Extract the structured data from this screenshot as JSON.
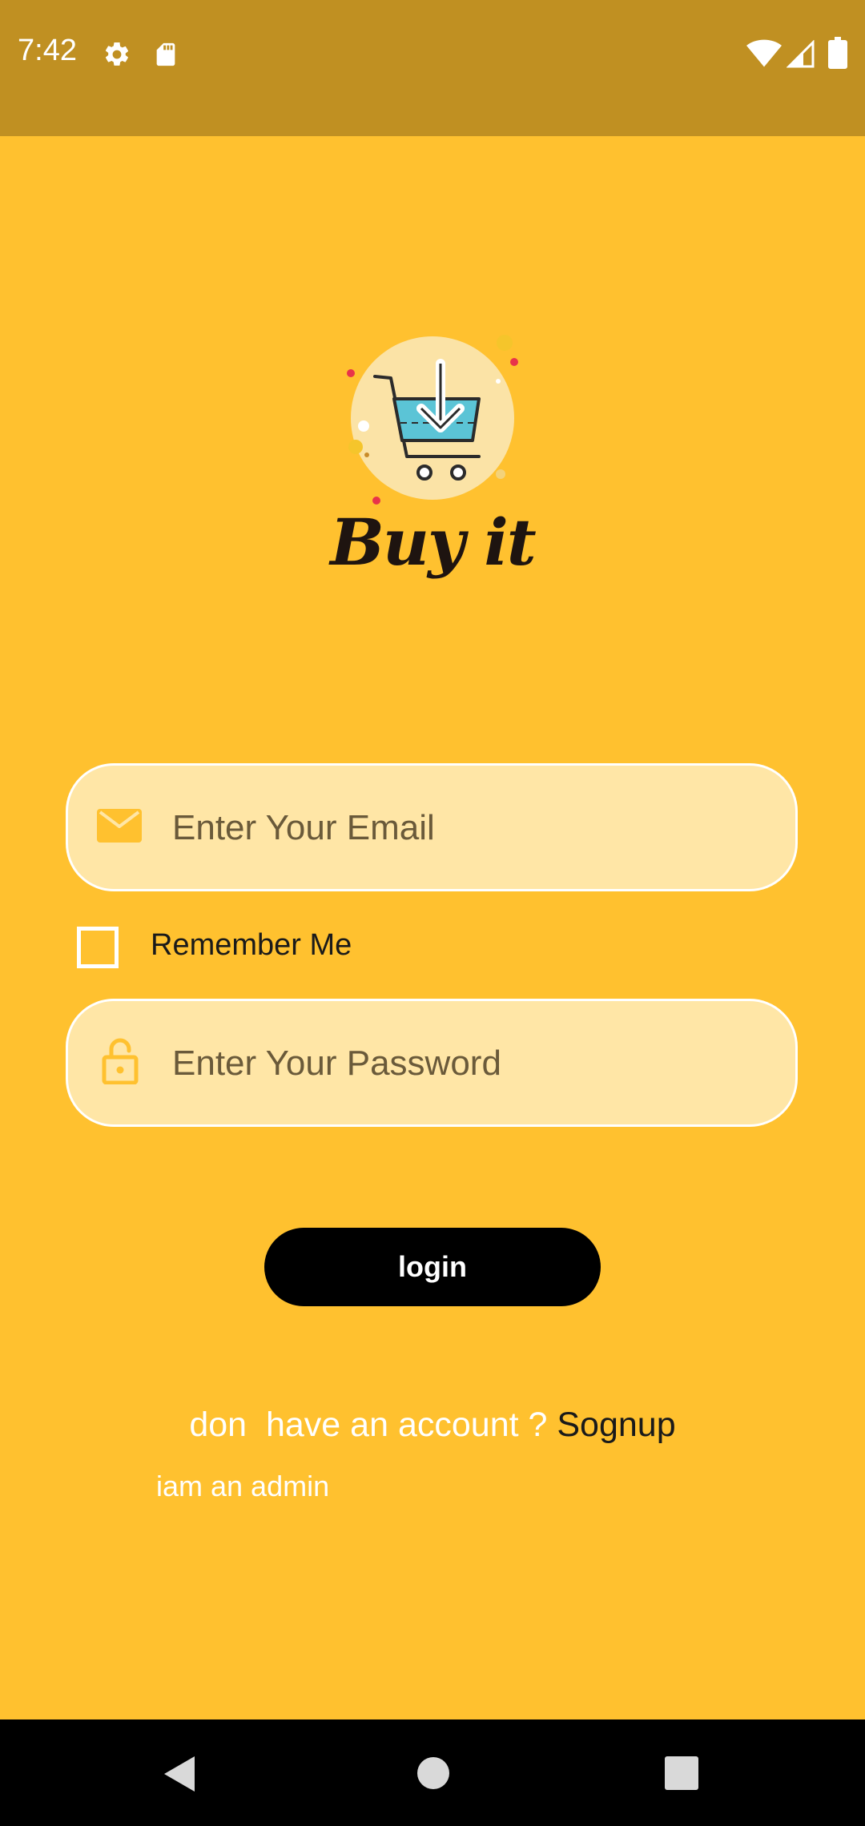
{
  "status_bar": {
    "time": "7:42",
    "icons": [
      "gear-icon",
      "sd-card-icon",
      "wifi-icon",
      "cell-signal-icon",
      "battery-icon"
    ]
  },
  "brand": {
    "name": "Buy it"
  },
  "login_form": {
    "email": {
      "placeholder": "Enter Your Email",
      "value": ""
    },
    "remember_me": {
      "label": "Remember Me",
      "checked": false
    },
    "password": {
      "placeholder": "Enter Your Password",
      "value": ""
    },
    "login_label": "login",
    "signup_prompt": "don  have an account ? ",
    "signup_link": "Sognup",
    "admin_link": "iam an admin"
  },
  "colors": {
    "background": "#FFC12F",
    "status_bar": "#C09022",
    "field_fill": "#FFE6A6",
    "button": "#000000"
  },
  "nav_bar": {
    "buttons": [
      "back-icon",
      "home-icon",
      "recents-icon"
    ]
  }
}
